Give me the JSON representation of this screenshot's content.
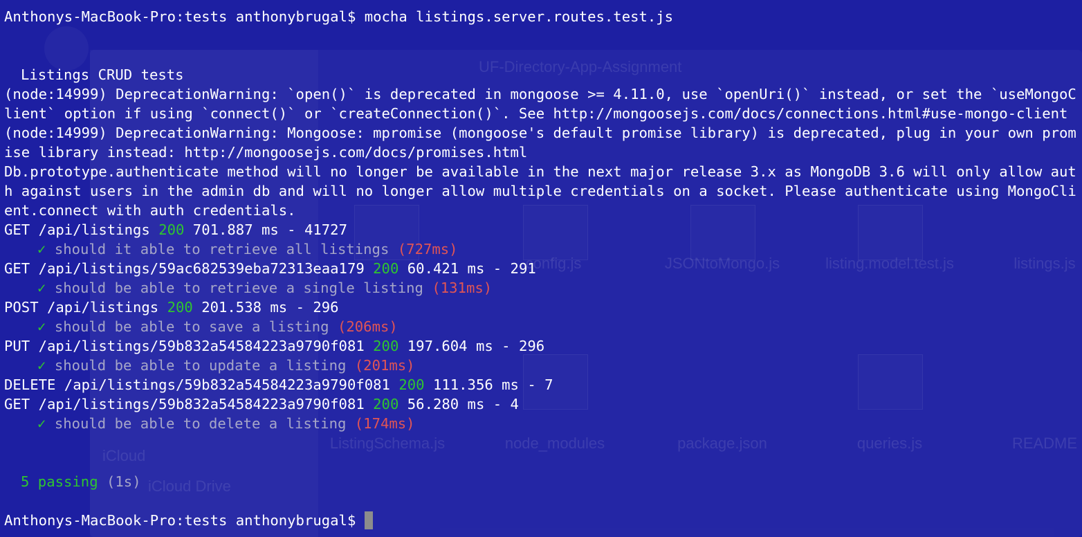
{
  "colors": {
    "background": "#1d1fa2",
    "text": "#ffffff",
    "status_ok": "#2fc52f",
    "slow_timing": "#e05555",
    "test_title": "#a6a6c8",
    "cursor": "#8c8c8c"
  },
  "terminal": {
    "prompt_1": "Anthonys-MacBook-Pro:tests anthonybrugal$ mocha listings.server.routes.test.js",
    "suite_title": "Listings CRUD tests",
    "warning_1": "(node:14999) DeprecationWarning: `open()` is deprecated in mongoose >= 4.11.0, use `openUri()` instead, or set the `useMongoClient` option if using `connect()` or `createConnection()`. See http://mongoosejs.com/docs/connections.html#use-mongo-client",
    "warning_2": "(node:14999) DeprecationWarning: Mongoose: mpromise (mongoose's default promise library) is deprecated, plug in your own promise library instead: http://mongoosejs.com/docs/promises.html",
    "auth_notice": "Db.prototype.authenticate method will no longer be available in the next major release 3.x as MongoDB 3.6 will only allow auth against users in the admin db and will no longer allow multiple credentials on a socket. Please authenticate using MongoClient.connect with auth credentials.",
    "requests": [
      {
        "method_path": "GET /api/listings",
        "status": "200",
        "tail": "701.887 ms - 41727"
      },
      {
        "method_path": "GET /api/listings/59ac682539eba72313eaa179",
        "status": "200",
        "tail": "60.421 ms - 291"
      },
      {
        "method_path": "POST /api/listings",
        "status": "200",
        "tail": "201.538 ms - 296"
      },
      {
        "method_path": "PUT /api/listings/59b832a54584223a9790f081",
        "status": "200",
        "tail": "197.604 ms - 296"
      },
      {
        "method_path": "DELETE /api/listings/59b832a54584223a9790f081",
        "status": "200",
        "tail": "111.356 ms - 7"
      },
      {
        "method_path": "GET /api/listings/59b832a54584223a9790f081",
        "status": "200",
        "tail": "56.280 ms - 4"
      }
    ],
    "tests": [
      {
        "mark": "✓",
        "title": "should it able to retrieve all listings",
        "time": "(727ms)"
      },
      {
        "mark": "✓",
        "title": "should be able to retrieve a single listing",
        "time": "(131ms)"
      },
      {
        "mark": "✓",
        "title": "should be able to save a listing",
        "time": "(206ms)"
      },
      {
        "mark": "✓",
        "title": "should be able to update a listing",
        "time": "(201ms)"
      },
      {
        "mark": "✓",
        "title": "should be able to delete a listing",
        "time": "(174ms)"
      }
    ],
    "summary_count": "5 passing",
    "summary_time": "(1s)",
    "prompt_2": "Anthonys-MacBook-Pro:tests anthonybrugal$"
  },
  "background_window": {
    "title": "UF-Directory-App-Assignment",
    "files": [
      "config.js",
      "JSONtoMongo.js",
      "listing.model.test.js",
      "listings.js",
      "ListingSchema.js",
      "node_modules",
      "package.json",
      "queries.js",
      "README"
    ],
    "sidebar": [
      "iCloud",
      "iCloud Drive"
    ]
  }
}
